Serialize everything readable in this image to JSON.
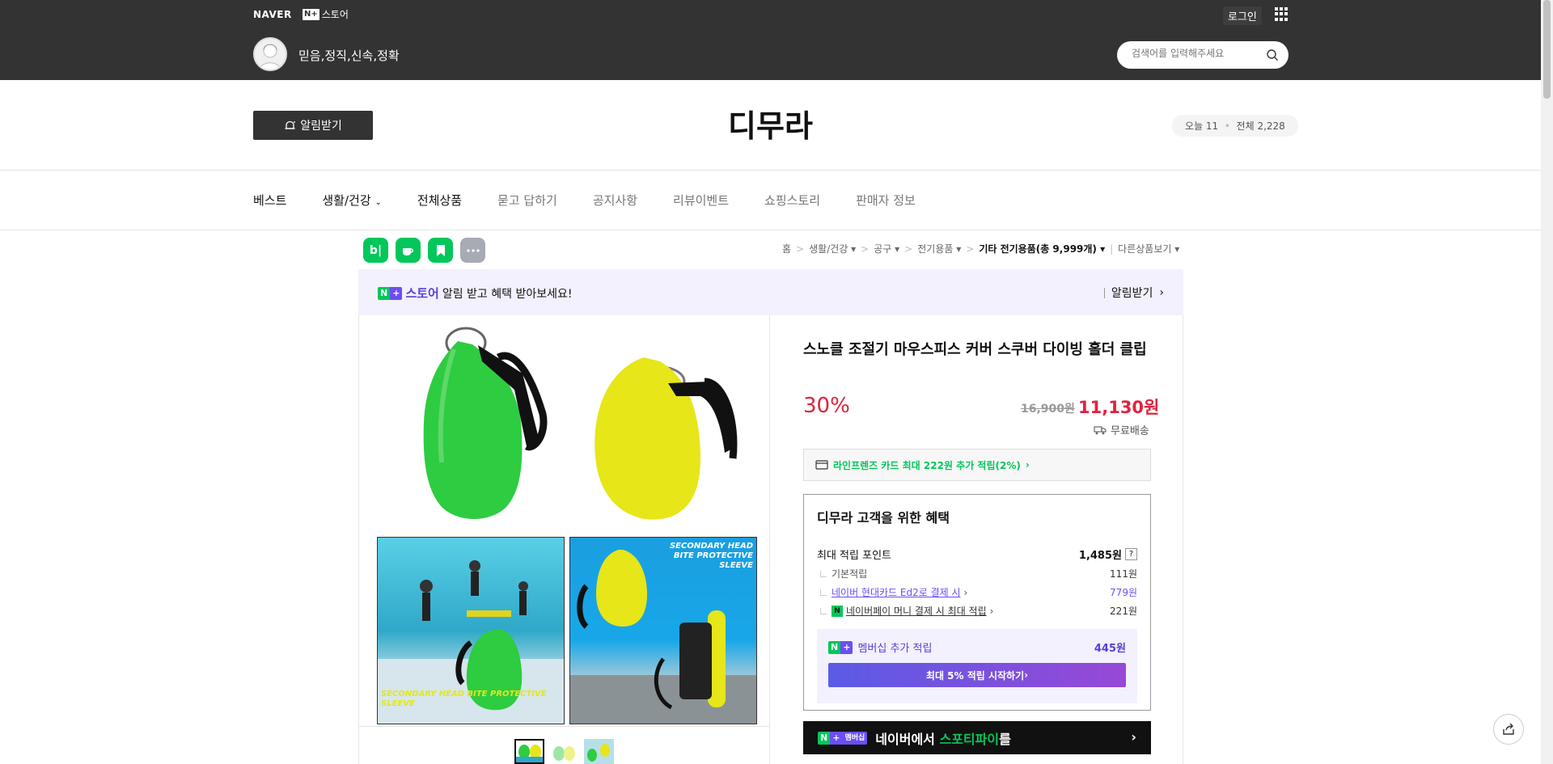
{
  "header": {
    "naver_logo": "NAVER",
    "nstore_badge": "N+",
    "nstore_label": "스토어",
    "login_label": "로그인",
    "slogan": "믿음,정직,신속,정확",
    "search_placeholder": "검색어를 입력해주세요"
  },
  "store": {
    "alarm_label": "알림받기",
    "name": "디무라",
    "visitors_today": "오늘 11",
    "visitors_total": "전체 2,228"
  },
  "nav": {
    "items": [
      "베스트",
      "생활/건강",
      "전체상품",
      "묻고 답하기",
      "공지사항",
      "리뷰이벤트",
      "쇼핑스토리",
      "판매자 정보"
    ]
  },
  "social": {
    "blog": "b|"
  },
  "breadcrumb": {
    "items": [
      "홈",
      "생활/건강",
      "공구",
      "전기용품"
    ],
    "current": "기타 전기용품(총 9,999개)",
    "other": "다른상품보기"
  },
  "banner": {
    "brand": "스토어",
    "message": "알림 받고 혜택 받아보세요!",
    "action": "알림받기"
  },
  "product": {
    "title": "스노클 조절기 마우스피스 커버 스쿠버 다이빙 홀더 클립",
    "discount": "30%",
    "original_price": "16,900원",
    "sale_price": "11,130원",
    "delivery": "무료배송",
    "card_benefit": "라인프렌즈 카드 최대 222원 추가 적립(2%) ",
    "img_caption_1": "SECONDARY HEAD BITE PROTECTIVE SLEEVE",
    "img_caption_2": "SECONDARY HEAD BITE PROTECTIVE SLEEVE"
  },
  "benefits": {
    "title": "디무라 고객을 위한 혜택",
    "max_points_label": "최대 적립 포인트",
    "max_points_value": "1,485원",
    "basic_label": "기본적립",
    "basic_value": "111원",
    "card_label": "네이버 현대카드 Ed2로 결제 시",
    "card_value": "779원",
    "pay_label": "네이버페이 머니 결제 시 최대 적립",
    "pay_value": "221원",
    "member_label": "멤버십 추가 적립",
    "member_value": "445원",
    "member_button": "최대 5% 적립 시작하기 "
  },
  "spotify": {
    "badge": "멤버십",
    "text_prefix": "네이버에서",
    "text_highlight": "스포티파이",
    "text_suffix": "를"
  },
  "colors": {
    "naver_green": "#03c75a",
    "sale_red": "#e0233c",
    "membership_purple": "#6c4ef5",
    "header_dark": "#333333"
  }
}
